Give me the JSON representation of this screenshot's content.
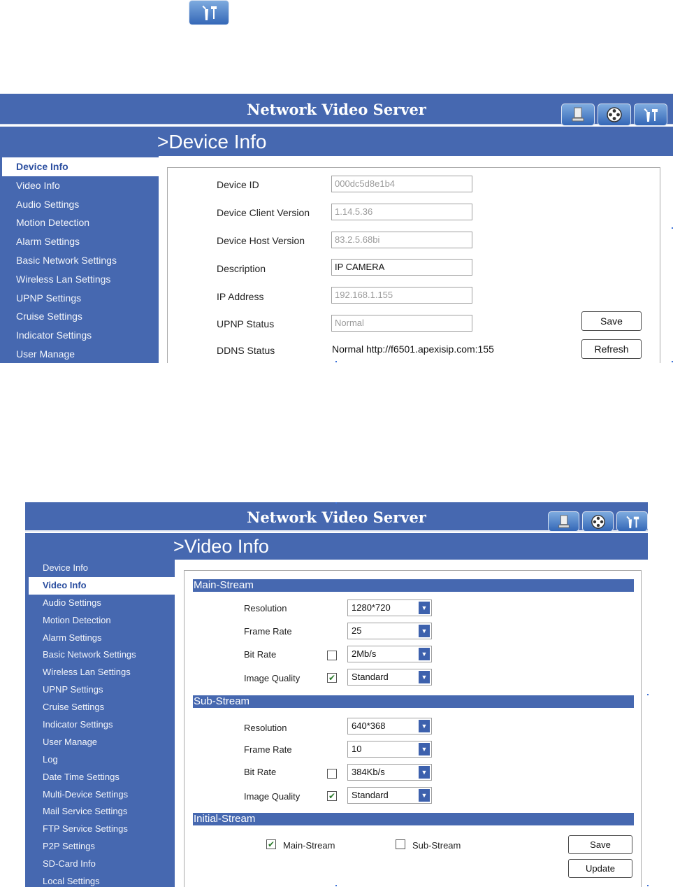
{
  "panel1": {
    "header_title": "Network Video Server",
    "page_title": ">Device Info",
    "nav": [
      {
        "label": "Device Info",
        "active": true
      },
      {
        "label": "Video Info"
      },
      {
        "label": "Audio Settings"
      },
      {
        "label": "Motion Detection"
      },
      {
        "label": "Alarm Settings"
      },
      {
        "label": "Basic Network Settings"
      },
      {
        "label": "Wireless Lan Settings"
      },
      {
        "label": "UPNP Settings"
      },
      {
        "label": "Cruise Settings"
      },
      {
        "label": "Indicator Settings"
      },
      {
        "label": "User Manage"
      }
    ],
    "fields": [
      {
        "label": "Device ID",
        "value": "000dc5d8e1b4"
      },
      {
        "label": "Device Client Version",
        "value": "1.14.5.36"
      },
      {
        "label": "Device Host Version",
        "value": "83.2.5.68bi"
      },
      {
        "label": "Description",
        "value": "IP CAMERA"
      },
      {
        "label": "IP Address",
        "value": "192.168.1.155"
      },
      {
        "label": "UPNP Status",
        "value": "Normal"
      },
      {
        "label": "DDNS Status",
        "value": "Normal http://f6501.apexisip.com:155"
      }
    ],
    "save_label": "Save",
    "refresh_label": "Refresh"
  },
  "panel2": {
    "header_title": "Network Video Server",
    "page_title": ">Video Info",
    "nav": [
      {
        "label": "Device Info"
      },
      {
        "label": "Video Info",
        "active": true
      },
      {
        "label": "Audio Settings"
      },
      {
        "label": "Motion Detection"
      },
      {
        "label": "Alarm Settings"
      },
      {
        "label": "Basic Network Settings"
      },
      {
        "label": "Wireless Lan Settings"
      },
      {
        "label": "UPNP Settings"
      },
      {
        "label": "Cruise Settings"
      },
      {
        "label": "Indicator Settings"
      },
      {
        "label": "User Manage"
      },
      {
        "label": "Log"
      },
      {
        "label": "Date Time Settings"
      },
      {
        "label": "Multi-Device Settings"
      },
      {
        "label": "Mail Service Settings"
      },
      {
        "label": "FTP Service Settings"
      },
      {
        "label": "P2P Settings"
      },
      {
        "label": "SD-Card Info"
      },
      {
        "label": "Local Settings"
      }
    ],
    "main_stream": {
      "title": "Main-Stream",
      "resolution_label": "Resolution",
      "resolution": "1280*720",
      "frame_rate_label": "Frame Rate",
      "frame_rate": "25",
      "bit_rate_label": "Bit Rate",
      "bit_rate": "2Mb/s",
      "bit_rate_checked": false,
      "image_quality_label": "Image Quality",
      "image_quality": "Standard",
      "image_quality_checked": true
    },
    "sub_stream": {
      "title": "Sub-Stream",
      "resolution_label": "Resolution",
      "resolution": "640*368",
      "frame_rate_label": "Frame Rate",
      "frame_rate": "10",
      "bit_rate_label": "Bit Rate",
      "bit_rate": "384Kb/s",
      "bit_rate_checked": false,
      "image_quality_label": "Image Quality",
      "image_quality": "Standard",
      "image_quality_checked": true
    },
    "initial_stream": {
      "title": "Initial-Stream",
      "main_label": "Main-Stream",
      "main_checked": true,
      "sub_label": "Sub-Stream",
      "sub_checked": false
    },
    "save_label": "Save",
    "update_label": "Update"
  },
  "icons": [
    "computer-icon",
    "film-reel-icon",
    "tools-icon"
  ]
}
